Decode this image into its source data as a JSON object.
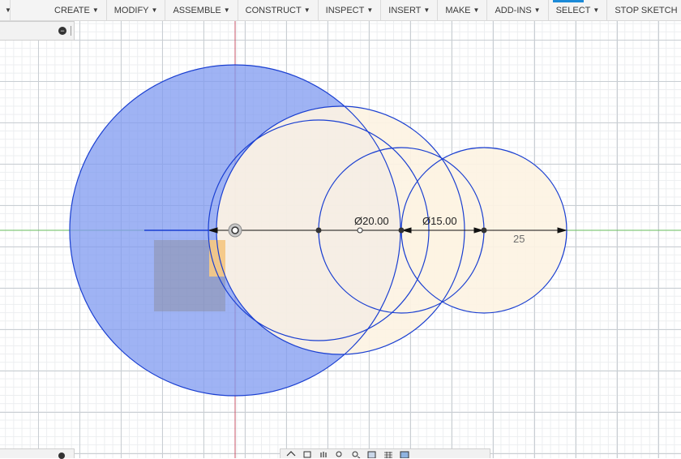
{
  "toolbar": {
    "menus": [
      {
        "label": "CREATE"
      },
      {
        "label": "MODIFY"
      },
      {
        "label": "ASSEMBLE"
      },
      {
        "label": "CONSTRUCT"
      },
      {
        "label": "INSPECT"
      },
      {
        "label": "INSERT"
      },
      {
        "label": "MAKE"
      },
      {
        "label": "ADD-INS"
      },
      {
        "label": "SELECT"
      },
      {
        "label": "STOP SKETCH"
      }
    ]
  },
  "browser_panel": {
    "collapse_icon": "minus-circle-icon"
  },
  "sketch": {
    "dimensions": {
      "diameter_large": "Ø20.00",
      "diameter_small": "Ø15.00",
      "linear": "25"
    },
    "colors": {
      "profile_fill_selected": "#7f9af0",
      "profile_fill_unselected": "#fdf3e3",
      "sketch_curve": "#1a3fd1",
      "dimension_line": "#111111",
      "x_axis": "#6abf5e",
      "y_axis": "#c9556a"
    }
  },
  "nav_bar": {
    "icons": [
      "orbit-icon",
      "look-at-icon",
      "pan-icon",
      "zoom-icon",
      "fit-icon",
      "display-settings-icon",
      "grid-settings-icon",
      "viewports-icon"
    ]
  }
}
